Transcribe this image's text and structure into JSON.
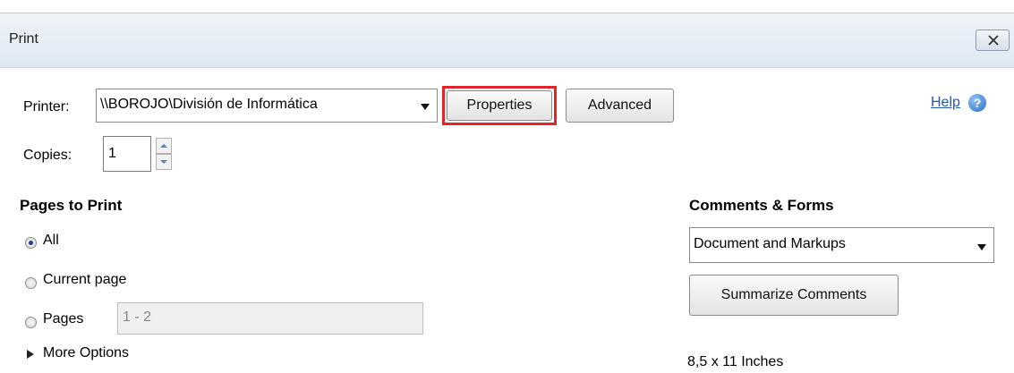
{
  "window": {
    "title": "Print"
  },
  "printer": {
    "label": "Printer:",
    "selected": "\\\\BOROJO\\División de Informática",
    "properties_label": "Properties",
    "advanced_label": "Advanced"
  },
  "help": {
    "label": "Help",
    "icon": "help-icon"
  },
  "copies": {
    "label": "Copies:",
    "value": "1"
  },
  "pages_to_print": {
    "heading": "Pages to Print",
    "options": [
      {
        "label": "All",
        "selected": true
      },
      {
        "label": "Current page",
        "selected": false
      },
      {
        "label": "Pages",
        "selected": false
      }
    ],
    "pages_value": "1 - 2",
    "more_options_label": "More Options"
  },
  "comments_forms": {
    "heading": "Comments & Forms",
    "selected": "Document and Markups",
    "summarize_label": "Summarize Comments",
    "paper_size": "8,5 x 11 Inches"
  },
  "colors": {
    "highlight": "#e0252b",
    "link": "#2557b8"
  }
}
